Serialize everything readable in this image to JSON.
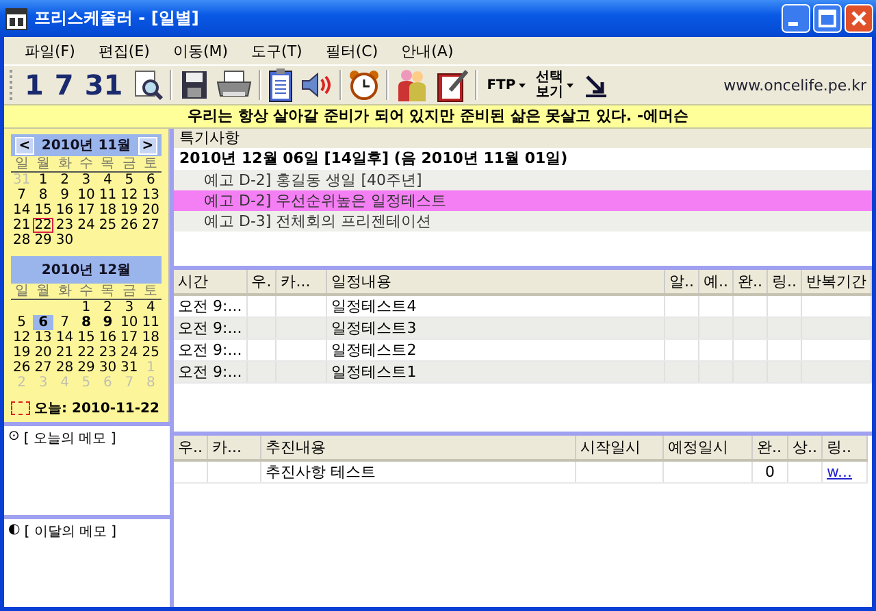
{
  "window": {
    "title": "프리스케줄러 - [일별]"
  },
  "menu": [
    "파일(F)",
    "편집(E)",
    "이동(M)",
    "도구(T)",
    "필터(C)",
    "안내(A)"
  ],
  "toolbar": {
    "day_buttons": [
      "1",
      "7",
      "31"
    ],
    "dropdowns": [
      "FTP",
      "선택\n보기"
    ],
    "website": "www.oncelife.pe.kr"
  },
  "quote": "우리는 항상 살아갈 준비가 되어 있지만 준비된 삶은 못살고 있다. -에머슨",
  "calendars": [
    {
      "title": "2010년 11월",
      "prev": "<",
      "next": ">",
      "weekdays": [
        "일",
        "월",
        "화",
        "수",
        "목",
        "금",
        "토"
      ],
      "weeks": [
        [
          {
            "day": "31",
            "muted": true,
            "today": false,
            "selected": false,
            "bold": false
          },
          {
            "day": "1",
            "muted": false,
            "today": false,
            "selected": false,
            "bold": false
          },
          {
            "day": "2",
            "muted": false,
            "today": false,
            "selected": false,
            "bold": false
          },
          {
            "day": "3",
            "muted": false,
            "today": false,
            "selected": false,
            "bold": false
          },
          {
            "day": "4",
            "muted": false,
            "today": false,
            "selected": false,
            "bold": false
          },
          {
            "day": "5",
            "muted": false,
            "today": false,
            "selected": false,
            "bold": false
          },
          {
            "day": "6",
            "muted": false,
            "today": false,
            "selected": false,
            "bold": false
          }
        ],
        [
          {
            "day": "7",
            "muted": false,
            "today": false,
            "selected": false,
            "bold": false
          },
          {
            "day": "8",
            "muted": false,
            "today": false,
            "selected": false,
            "bold": false
          },
          {
            "day": "9",
            "muted": false,
            "today": false,
            "selected": false,
            "bold": false
          },
          {
            "day": "10",
            "muted": false,
            "today": false,
            "selected": false,
            "bold": false
          },
          {
            "day": "11",
            "muted": false,
            "today": false,
            "selected": false,
            "bold": false
          },
          {
            "day": "12",
            "muted": false,
            "today": false,
            "selected": false,
            "bold": false
          },
          {
            "day": "13",
            "muted": false,
            "today": false,
            "selected": false,
            "bold": false
          }
        ],
        [
          {
            "day": "14",
            "muted": false,
            "today": false,
            "selected": false,
            "bold": false
          },
          {
            "day": "15",
            "muted": false,
            "today": false,
            "selected": false,
            "bold": false
          },
          {
            "day": "16",
            "muted": false,
            "today": false,
            "selected": false,
            "bold": false
          },
          {
            "day": "17",
            "muted": false,
            "today": false,
            "selected": false,
            "bold": false
          },
          {
            "day": "18",
            "muted": false,
            "today": false,
            "selected": false,
            "bold": false
          },
          {
            "day": "19",
            "muted": false,
            "today": false,
            "selected": false,
            "bold": false
          },
          {
            "day": "20",
            "muted": false,
            "today": false,
            "selected": false,
            "bold": false
          }
        ],
        [
          {
            "day": "21",
            "muted": false,
            "today": false,
            "selected": false,
            "bold": false
          },
          {
            "day": "22",
            "muted": false,
            "today": true,
            "selected": false,
            "bold": false
          },
          {
            "day": "23",
            "muted": false,
            "today": false,
            "selected": false,
            "bold": false
          },
          {
            "day": "24",
            "muted": false,
            "today": false,
            "selected": false,
            "bold": false
          },
          {
            "day": "25",
            "muted": false,
            "today": false,
            "selected": false,
            "bold": false
          },
          {
            "day": "26",
            "muted": false,
            "today": false,
            "selected": false,
            "bold": false
          },
          {
            "day": "27",
            "muted": false,
            "today": false,
            "selected": false,
            "bold": false
          }
        ],
        [
          {
            "day": "28",
            "muted": false,
            "today": false,
            "selected": false,
            "bold": false
          },
          {
            "day": "29",
            "muted": false,
            "today": false,
            "selected": false,
            "bold": false
          },
          {
            "day": "30",
            "muted": false,
            "today": false,
            "selected": false,
            "bold": false
          }
        ]
      ]
    },
    {
      "title": "2010년 12월",
      "weekdays": [
        "일",
        "월",
        "화",
        "수",
        "목",
        "금",
        "토"
      ],
      "weeks": [
        [
          {
            "day": "1",
            "muted": false,
            "today": false,
            "selected": false,
            "bold": false
          },
          {
            "day": "2",
            "muted": false,
            "today": false,
            "selected": false,
            "bold": false
          },
          {
            "day": "3",
            "muted": false,
            "today": false,
            "selected": false,
            "bold": false
          },
          {
            "day": "4",
            "muted": false,
            "today": false,
            "selected": false,
            "bold": false
          }
        ],
        [
          {
            "day": "5",
            "muted": false,
            "today": false,
            "selected": false,
            "bold": false
          },
          {
            "day": "6",
            "muted": false,
            "today": false,
            "selected": true,
            "bold": true
          },
          {
            "day": "7",
            "muted": false,
            "today": false,
            "selected": false,
            "bold": false
          },
          {
            "day": "8",
            "muted": false,
            "today": false,
            "selected": false,
            "bold": true
          },
          {
            "day": "9",
            "muted": false,
            "today": false,
            "selected": false,
            "bold": true
          },
          {
            "day": "10",
            "muted": false,
            "today": false,
            "selected": false,
            "bold": false
          },
          {
            "day": "11",
            "muted": false,
            "today": false,
            "selected": false,
            "bold": false
          }
        ],
        [
          {
            "day": "12",
            "muted": false,
            "today": false,
            "selected": false,
            "bold": false
          },
          {
            "day": "13",
            "muted": false,
            "today": false,
            "selected": false,
            "bold": false
          },
          {
            "day": "14",
            "muted": false,
            "today": false,
            "selected": false,
            "bold": false
          },
          {
            "day": "15",
            "muted": false,
            "today": false,
            "selected": false,
            "bold": false
          },
          {
            "day": "16",
            "muted": false,
            "today": false,
            "selected": false,
            "bold": false
          },
          {
            "day": "17",
            "muted": false,
            "today": false,
            "selected": false,
            "bold": false
          },
          {
            "day": "18",
            "muted": false,
            "today": false,
            "selected": false,
            "bold": false
          }
        ],
        [
          {
            "day": "19",
            "muted": false,
            "today": false,
            "selected": false,
            "bold": false
          },
          {
            "day": "20",
            "muted": false,
            "today": false,
            "selected": false,
            "bold": false
          },
          {
            "day": "21",
            "muted": false,
            "today": false,
            "selected": false,
            "bold": false
          },
          {
            "day": "22",
            "muted": false,
            "today": false,
            "selected": false,
            "bold": false
          },
          {
            "day": "23",
            "muted": false,
            "today": false,
            "selected": false,
            "bold": false
          },
          {
            "day": "24",
            "muted": false,
            "today": false,
            "selected": false,
            "bold": false
          },
          {
            "day": "25",
            "muted": false,
            "today": false,
            "selected": false,
            "bold": false
          }
        ],
        [
          {
            "day": "26",
            "muted": false,
            "today": false,
            "selected": false,
            "bold": false
          },
          {
            "day": "27",
            "muted": false,
            "today": false,
            "selected": false,
            "bold": false
          },
          {
            "day": "28",
            "muted": false,
            "today": false,
            "selected": false,
            "bold": false
          },
          {
            "day": "29",
            "muted": false,
            "today": false,
            "selected": false,
            "bold": false
          },
          {
            "day": "30",
            "muted": false,
            "today": false,
            "selected": false,
            "bold": false
          },
          {
            "day": "31",
            "muted": false,
            "today": false,
            "selected": false,
            "bold": false
          },
          {
            "day": "1",
            "muted": true,
            "today": false,
            "selected": false,
            "bold": false
          }
        ],
        [
          {
            "day": "2",
            "muted": true,
            "today": false,
            "selected": false,
            "bold": false
          },
          {
            "day": "3",
            "muted": true,
            "today": false,
            "selected": false,
            "bold": false
          },
          {
            "day": "4",
            "muted": true,
            "today": false,
            "selected": false,
            "bold": false
          },
          {
            "day": "5",
            "muted": true,
            "today": false,
            "selected": false,
            "bold": false
          },
          {
            "day": "6",
            "muted": true,
            "today": false,
            "selected": false,
            "bold": false
          },
          {
            "day": "7",
            "muted": true,
            "today": false,
            "selected": false,
            "bold": false
          },
          {
            "day": "8",
            "muted": true,
            "today": false,
            "selected": false,
            "bold": false
          }
        ]
      ]
    }
  ],
  "today_label": "오늘: 2010-11-22",
  "memos": [
    {
      "symbol": "⊙",
      "label": "[ 오늘의 메모 ]"
    },
    {
      "symbol": "◐",
      "label": "[ 이달의 메모 ]"
    }
  ],
  "notices": {
    "header": "특기사항",
    "date_line": "2010년 12월 06일 [14일후]  (음 2010년 11월 01일)",
    "items": [
      {
        "text": "예고 D-2] 홍길동 생일 [40주년]",
        "selected": false
      },
      {
        "text": "예고 D-2] 우선순위높은 일정테스트",
        "selected": true
      },
      {
        "text": "예고 D-3] 전체회의 프리젠테이션",
        "selected": false
      }
    ]
  },
  "schedule": {
    "columns": [
      "시간",
      "우.",
      "카...",
      "일정내용",
      "알..",
      "예..",
      "완..",
      "링..",
      "반복기간"
    ],
    "rows": [
      {
        "time": "오전 9:...",
        "content": "일정테스트4"
      },
      {
        "time": "오전 9:...",
        "content": "일정테스트3"
      },
      {
        "time": "오전 9:...",
        "content": "일정테스트2"
      },
      {
        "time": "오전 9:...",
        "content": "일정테스트1"
      }
    ]
  },
  "tasks": {
    "columns": [
      "우..",
      "카...",
      "추진내용",
      "시작일시",
      "예정일시",
      "완..",
      "상..",
      "링.."
    ],
    "rows": [
      {
        "content": "추진사항 테스트",
        "column_6": "0",
        "link": "w..."
      }
    ]
  }
}
